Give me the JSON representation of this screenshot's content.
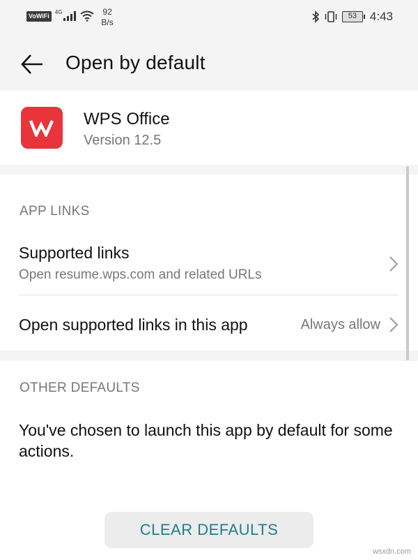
{
  "status_bar": {
    "vowifi": "VoWiFi",
    "network": "4G",
    "speed_value": "92",
    "speed_unit": "B/s",
    "battery": "53",
    "time": "4:43",
    "icons": [
      "signal-icon",
      "wifi-icon",
      "bluetooth-icon",
      "vibrate-icon",
      "battery-icon"
    ]
  },
  "header": {
    "title": "Open by default"
  },
  "app": {
    "name": "WPS Office",
    "version": "Version 12.5",
    "icon_color": "#e8343b"
  },
  "app_links": {
    "section_title": "APP LINKS",
    "supported": {
      "title": "Supported links",
      "subtitle": "Open resume.wps.com and related URLs"
    },
    "open_in_app": {
      "title": "Open supported links in this app",
      "value": "Always allow"
    }
  },
  "other_defaults": {
    "section_title": "OTHER DEFAULTS",
    "description": "You've chosen to launch this app by default for some actions.",
    "clear_button": "CLEAR DEFAULTS"
  },
  "colors": {
    "accent": "#1f7d8e",
    "background": "#f4f4f4",
    "card": "#ffffff"
  },
  "watermark": "wsxdn.com"
}
